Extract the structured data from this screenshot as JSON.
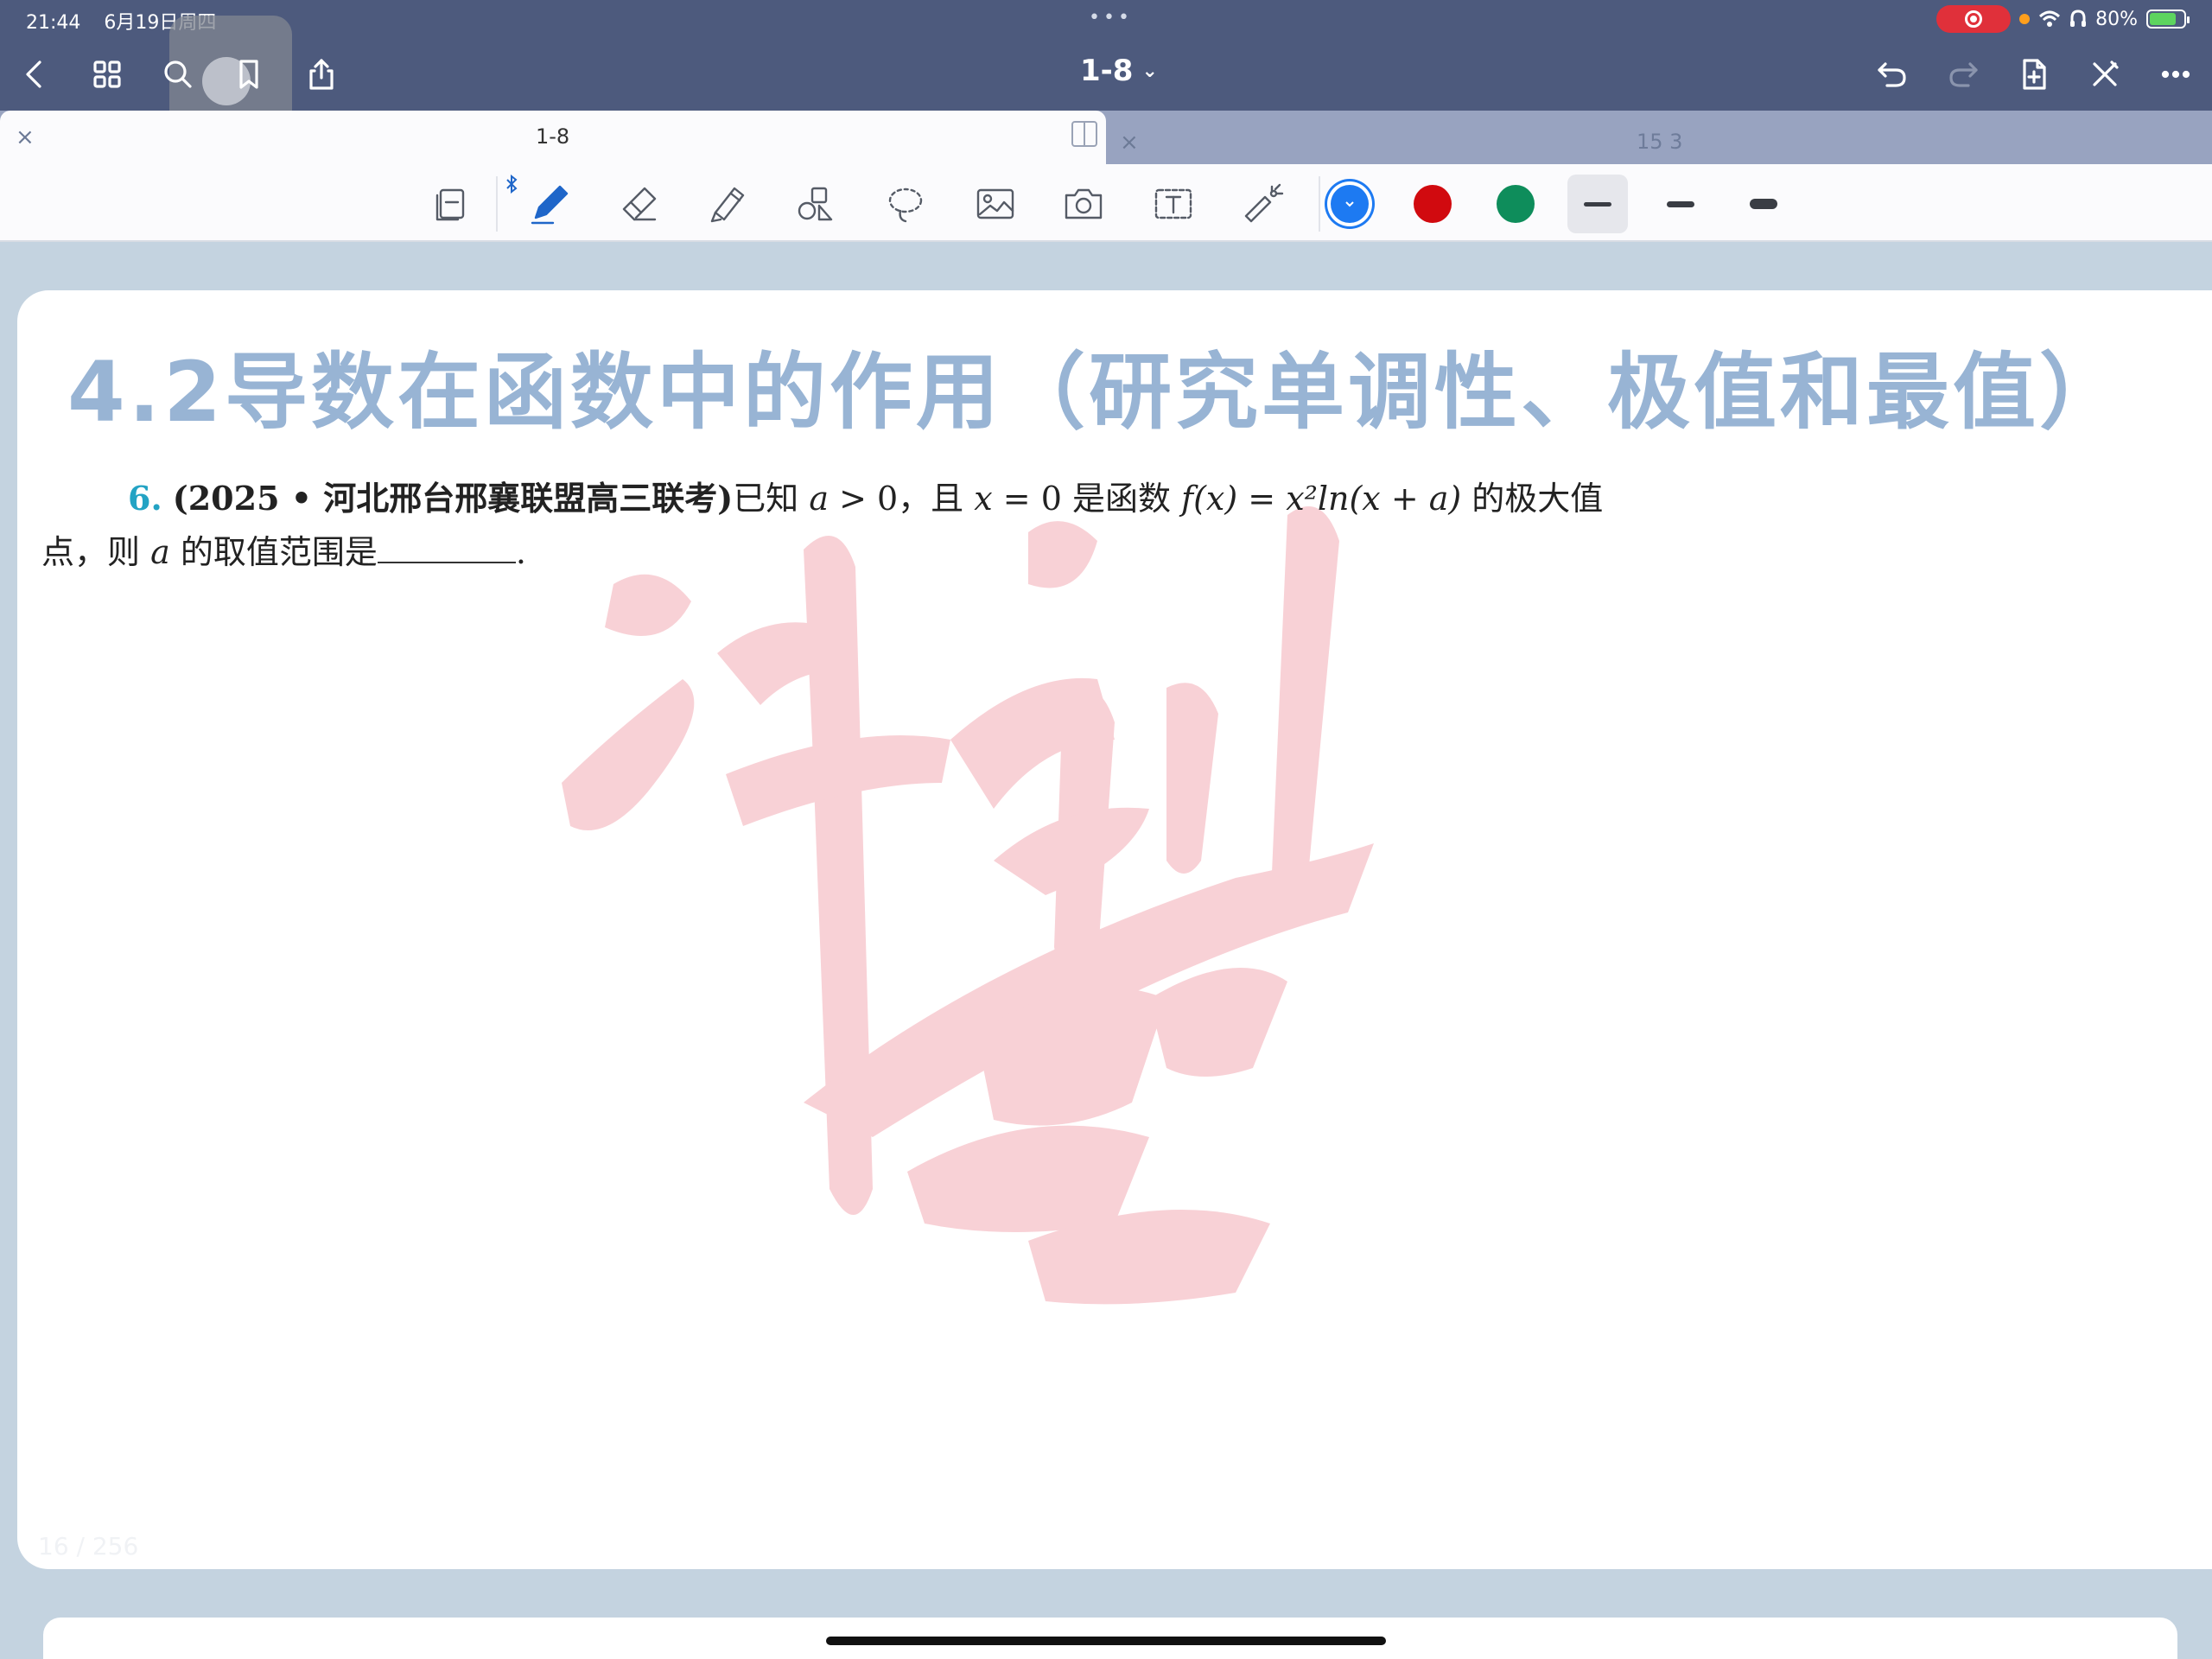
{
  "status_bar": {
    "time": "21:44",
    "date": "6月19日周四",
    "battery_percent": "80%",
    "battery_level": 0.8
  },
  "nav": {
    "doc_title": "1-8",
    "icons": [
      "back-icon",
      "grid-icon",
      "search-icon",
      "bookmark-icon",
      "share-icon",
      "undo-icon",
      "redo-icon",
      "add-page-icon",
      "close-pen-icon",
      "more-icon"
    ]
  },
  "tabs": [
    {
      "label": "1-8",
      "active": true
    },
    {
      "label": "15 3",
      "active": false
    }
  ],
  "toolbar": {
    "tools": [
      "page-view-icon",
      "pen-icon",
      "eraser-icon",
      "highlighter-icon",
      "shapes-icon",
      "lasso-icon",
      "image-icon",
      "camera-icon",
      "text-box-icon",
      "laser-pointer-icon"
    ],
    "colors": [
      {
        "name": "blue",
        "hex": "#1d7af2",
        "selected": true
      },
      {
        "name": "red",
        "hex": "#d10a0f",
        "selected": false
      },
      {
        "name": "green",
        "hex": "#0e8d5b",
        "selected": false
      }
    ],
    "stroke_sizes": [
      {
        "size": "thin",
        "selected": true
      },
      {
        "size": "medium",
        "selected": false
      },
      {
        "size": "thick",
        "selected": false
      }
    ]
  },
  "document": {
    "title": "4.2导数在函数中的作用（研究单调性、极值和最值）",
    "question": {
      "number": "6.",
      "source": "(2025 • 河北邢台邢襄联盟高三联考)",
      "text_part1": "已知 ",
      "a": "a",
      "gt": " > 0，且 ",
      "x_eq": "x",
      "eq0": " = 0 是函数 ",
      "fx": "f(x) = x²ln(x + a)",
      "tail1": " 的极大值",
      "line2_pre": "点，则 ",
      "line2_a": "a",
      "line2_post": " 的取值范围是",
      "period": "."
    },
    "page_counter": "16 / 256"
  },
  "colors": {
    "nav_bg": "#4d5a7d",
    "tab_bg": "#98a3c0",
    "page_bg_area": "#c4d3e0",
    "title_color": "#98b4d4",
    "accent_blue": "#1d7af2"
  }
}
